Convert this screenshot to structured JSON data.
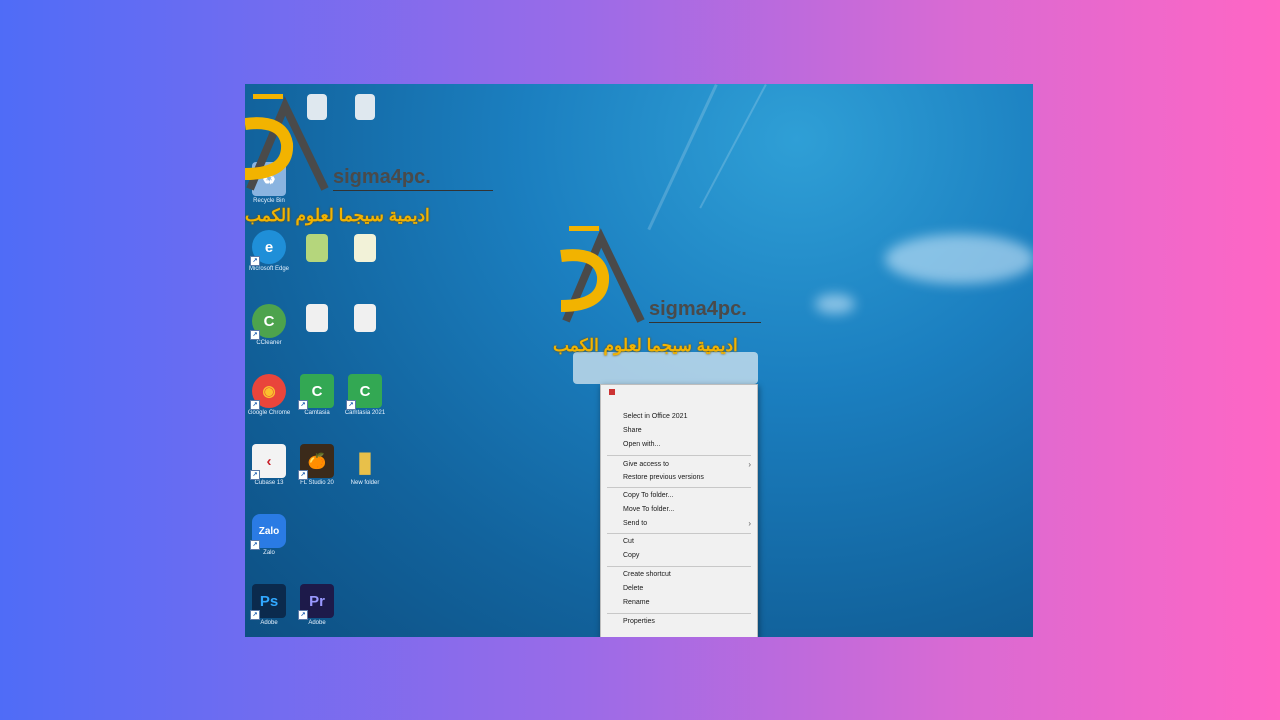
{
  "watermark": {
    "site": "sigma4pc.",
    "arabic": "اديمية سيجما لعلوم الكمب"
  },
  "desktop_icons": [
    {
      "label": "Recycle Bin",
      "icon": "recycle-bin-icon",
      "color": "#8ab4e0",
      "glyph": "♻"
    },
    {
      "label": "Microsoft Edge",
      "icon": "edge-icon",
      "color": "#1f8fd8",
      "glyph": "e"
    },
    {
      "label": "CCleaner",
      "icon": "ccleaner-icon",
      "color": "#4da34d",
      "glyph": "C"
    },
    {
      "label": "Google Chrome",
      "icon": "chrome-icon",
      "color": "#e9453b",
      "glyph": "◉"
    },
    {
      "label": "Cubase 13",
      "icon": "cubase-icon",
      "color": "#f3f3f3",
      "glyph": "‹"
    },
    {
      "label": "Zalo",
      "icon": "zalo-icon",
      "color": "#2a7be4",
      "glyph": "Zalo"
    },
    {
      "label": "Adobe",
      "icon": "photoshop-icon",
      "color": "#0b2a4d",
      "glyph": "Ps"
    },
    {
      "label": "Camtasia",
      "icon": "camtasia-icon",
      "color": "#33a853",
      "glyph": "C"
    },
    {
      "label": "Camtasia",
      "icon": "camtasia-icon",
      "color": "#33a853",
      "glyph": "C"
    },
    {
      "label": "FL Studio 20",
      "icon": "fl-studio-icon",
      "color": "#e26b1d",
      "glyph": "🍊"
    },
    {
      "label": "Adobe",
      "icon": "premiere-icon",
      "color": "#1d1a4a",
      "glyph": "Pr"
    },
    {
      "label": "Camtasia 2021",
      "icon": "camtasia-icon",
      "color": "#33a853",
      "glyph": "C"
    },
    {
      "label": "New folder",
      "icon": "folder-icon",
      "color": "#e8c04a",
      "glyph": "▮"
    }
  ],
  "context_menu": {
    "items": [
      {
        "label": "Select in Office 2021",
        "group": 0
      },
      {
        "label": "Share",
        "group": 0
      },
      {
        "label": "Open with...",
        "group": 0
      },
      {
        "label": "Give access to",
        "group": 1,
        "submenu": true
      },
      {
        "label": "Restore previous versions",
        "group": 1
      },
      {
        "label": "Copy To folder...",
        "group": 2
      },
      {
        "label": "Move To folder...",
        "group": 2
      },
      {
        "label": "Send to",
        "group": 2,
        "submenu": true
      },
      {
        "label": "Cut",
        "group": 3
      },
      {
        "label": "Copy",
        "group": 3
      },
      {
        "label": "Create shortcut",
        "group": 4
      },
      {
        "label": "Delete",
        "group": 4
      },
      {
        "label": "Rename",
        "group": 4
      },
      {
        "label": "Properties",
        "group": 5
      }
    ],
    "chevron": "›"
  }
}
